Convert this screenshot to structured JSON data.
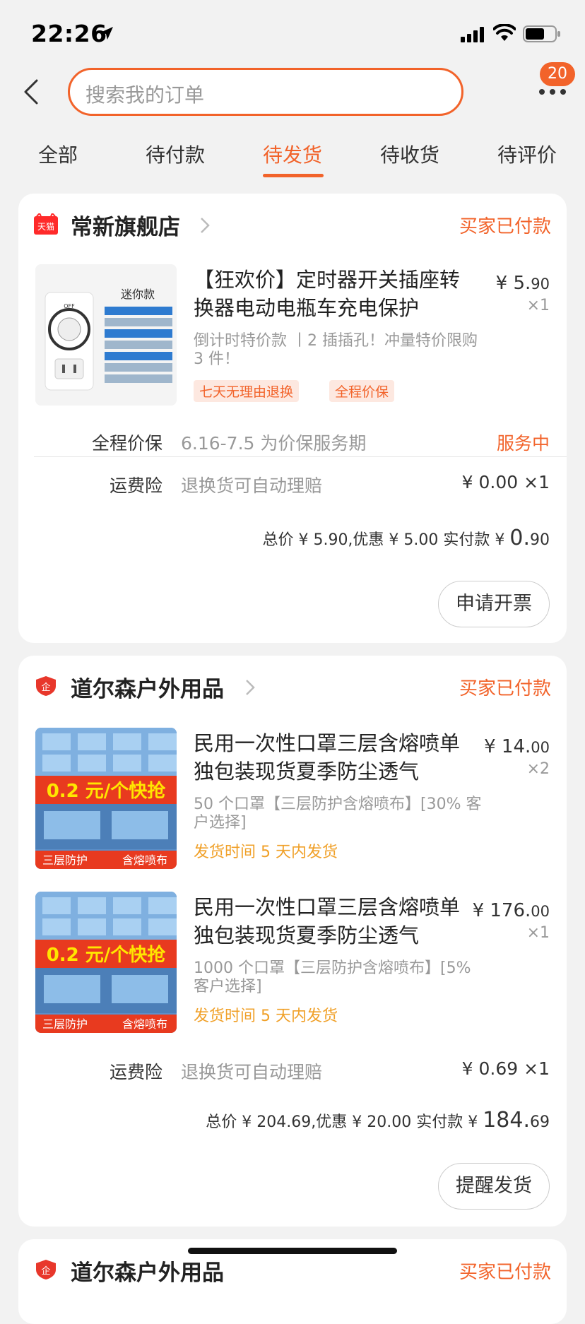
{
  "status_bar": {
    "time": "22:26"
  },
  "header": {
    "search_placeholder": "搜索我的订单",
    "badge_count": "20"
  },
  "tabs": [
    {
      "label": "全部"
    },
    {
      "label": "待付款"
    },
    {
      "label": "待发货",
      "active": true
    },
    {
      "label": "待收货"
    },
    {
      "label": "待评价"
    }
  ],
  "orders": [
    {
      "shop_logo": "tmall-logo",
      "shop_logo_text": "天猫",
      "shop_name": "常新旗舰店",
      "status": "买家已付款",
      "items": [
        {
          "title": "【狂欢价】定时器开关插座转换器电动电瓶车充电保护",
          "sku": "倒计时特价款 丨2 插插孔！冲量特价限购 3 件！",
          "tags": [
            "七天无理由退换",
            "全程价保"
          ],
          "price_int": "¥ 5.",
          "price_dec": "90",
          "qty": "×1",
          "thumb_label": "迷你款",
          "thumb_knob": "OFF"
        }
      ],
      "services": [
        {
          "label": "全程价保",
          "desc": "6.16-7.5 为价保服务期",
          "right": "服务中"
        },
        {
          "label": "运费险",
          "desc": "退换货可自动理赔",
          "right": "¥ 0.00 ×1"
        }
      ],
      "total_prefix": "总价 ¥ 5.90,优惠 ¥ 5.00  实付款 ¥ ",
      "total_big": "0.",
      "total_small": "90",
      "action": "申请开票"
    },
    {
      "shop_logo": "enterprise-shield-logo",
      "shop_logo_text": "企",
      "shop_name": "道尔森户外用品",
      "status": "买家已付款",
      "items": [
        {
          "title": "民用一次性口罩三层含熔喷单独包装现货夏季防尘透气",
          "sku": "50 个口罩【三层防护含熔喷布】[30% 客户选择]",
          "delivery": "发货时间  5 天内发货",
          "price_int": "¥ 14.",
          "price_dec": "00",
          "qty": "×2",
          "thumb_banner": "0.2 元/个快抢",
          "thumb_left": "三层防护",
          "thumb_right": "含熔喷布"
        },
        {
          "title": "民用一次性口罩三层含熔喷单独包装现货夏季防尘透气",
          "sku": "1000 个口罩【三层防护含熔喷布】[5% 客户选择]",
          "delivery": "发货时间  5 天内发货",
          "price_int": "¥ 176.",
          "price_dec": "00",
          "qty": "×1",
          "thumb_banner": "0.2 元/个快抢",
          "thumb_left": "三层防护",
          "thumb_right": "含熔喷布"
        }
      ],
      "services": [
        {
          "label": "运费险",
          "desc": "退换货可自动理赔",
          "right": "¥ 0.69 ×1"
        }
      ],
      "total_prefix": "总价 ¥ 204.69,优惠 ¥ 20.00  实付款 ¥ ",
      "total_big": "184.",
      "total_small": "69",
      "action": "提醒发货"
    },
    {
      "shop_logo_text": "企",
      "shop_name": "道尔森户外用品",
      "status": "买家已付款"
    }
  ],
  "colors": {
    "accent": "#f2632a",
    "delivery": "#f0a028"
  }
}
